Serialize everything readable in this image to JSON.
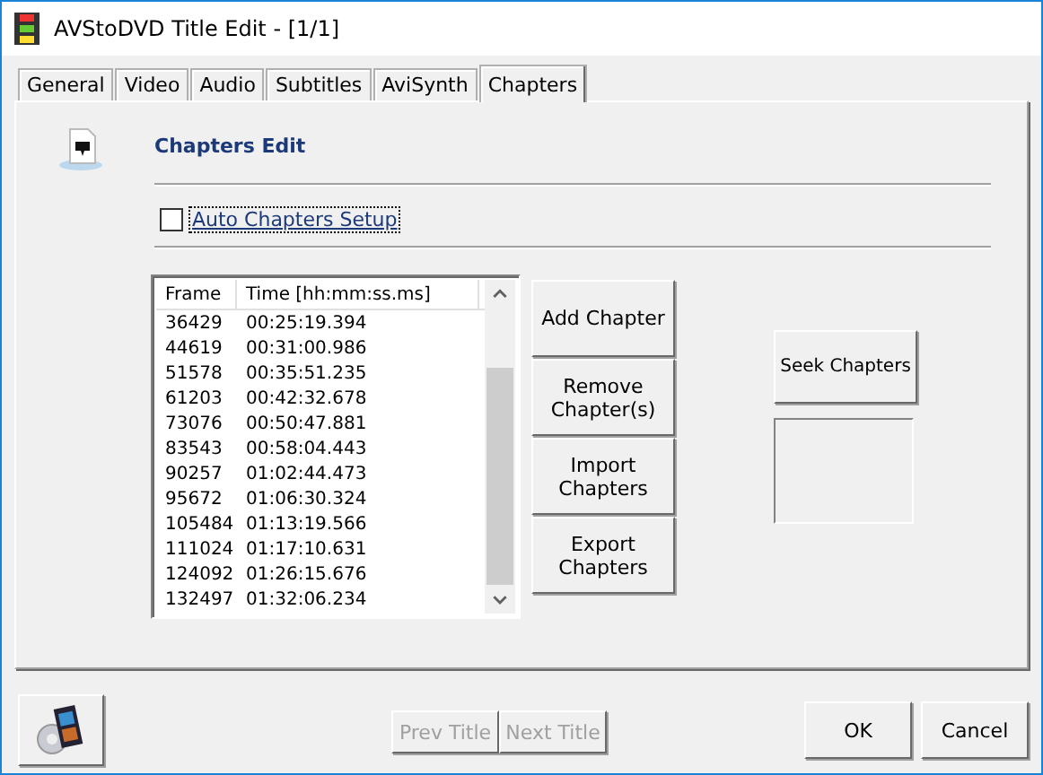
{
  "window": {
    "title": "AVStoDVD Title Edit - [1/1]"
  },
  "tabs": [
    {
      "label": "General",
      "selected": false
    },
    {
      "label": "Video",
      "selected": false
    },
    {
      "label": "Audio",
      "selected": false
    },
    {
      "label": "Subtitles",
      "selected": false
    },
    {
      "label": "AviSynth",
      "selected": false
    },
    {
      "label": "Chapters",
      "selected": true
    }
  ],
  "section_title": "Chapters Edit",
  "auto_chapters": {
    "label": "Auto Chapters Setup",
    "checked": false
  },
  "chapter_list": {
    "columns": [
      "Frame",
      "Time [hh:mm:ss.ms]"
    ],
    "rows": [
      [
        "36429",
        "00:25:19.394"
      ],
      [
        "44619",
        "00:31:00.986"
      ],
      [
        "51578",
        "00:35:51.235"
      ],
      [
        "61203",
        "00:42:32.678"
      ],
      [
        "73076",
        "00:50:47.881"
      ],
      [
        "83543",
        "00:58:04.443"
      ],
      [
        "90257",
        "01:02:44.473"
      ],
      [
        "95672",
        "01:06:30.324"
      ],
      [
        "105484",
        "01:13:19.566"
      ],
      [
        "111024",
        "01:17:10.631"
      ],
      [
        "124092",
        "01:26:15.676"
      ],
      [
        "132497",
        "01:32:06.234"
      ]
    ]
  },
  "chapter_buttons": [
    "Add Chapter",
    "Remove Chapter(s)",
    "Import Chapters",
    "Export Chapters"
  ],
  "seek_button": "Seek Chapters",
  "nav_buttons": [
    {
      "label": "Prev Title",
      "disabled": true
    },
    {
      "label": "Next Title",
      "disabled": true
    }
  ],
  "dialog_buttons": [
    "OK",
    "Cancel"
  ]
}
